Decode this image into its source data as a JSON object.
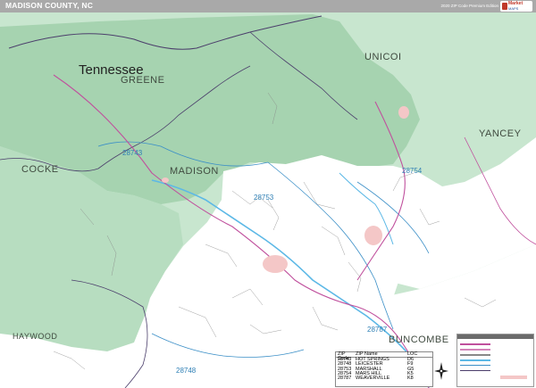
{
  "header": {
    "title": "MADISON COUNTY, NC",
    "edition": "2020 ZIP Code Premium Edition",
    "logo_line1": "Market",
    "logo_line2": "MAPS"
  },
  "colors": {
    "surrounding_county": "#c8e6cf",
    "mountain_area": "#a6d3b0",
    "madison_county": "#ffffff",
    "town_fill": "#f4c7c7",
    "water": "#5cb8e6",
    "zip_boundary": "#3b8fc7",
    "county_line": "#4b3e6b",
    "highway": "#c0509d",
    "road": "#888888"
  },
  "map": {
    "state_label": "Tennessee",
    "counties": [
      "GREENE",
      "UNICOI",
      "YANCEY",
      "COCKE",
      "MADISON",
      "HAYWOOD",
      "BUNCOMBE"
    ],
    "zip_labels": [
      "28743",
      "28753",
      "28754",
      "28787",
      "28748"
    ]
  },
  "legend_table": {
    "headers": [
      "ZIP Code",
      "ZIP Name",
      "LOC"
    ],
    "rows": [
      {
        "zip": "28743",
        "name": "HOT SPRINGS",
        "loc": "D6"
      },
      {
        "zip": "28748",
        "name": "LEICESTER",
        "loc": "F9"
      },
      {
        "zip": "28753",
        "name": "MARSHALL",
        "loc": "G5"
      },
      {
        "zip": "28754",
        "name": "MARS HILL",
        "loc": "K5"
      },
      {
        "zip": "28787",
        "name": "WEAVERVILLE",
        "loc": "K8"
      }
    ]
  }
}
